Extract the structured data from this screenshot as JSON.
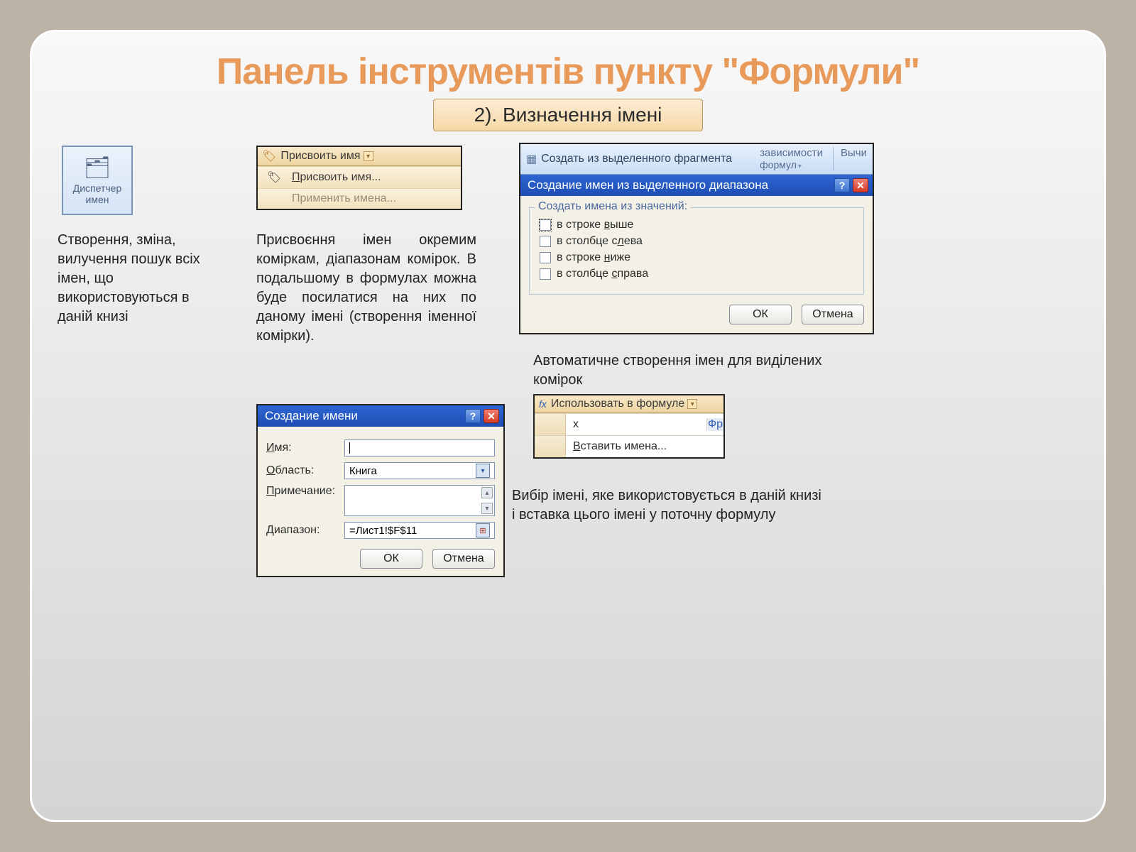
{
  "title": "Панель інструментів пункту \"Формули\"",
  "subtitle": "2). Визначення імені",
  "manager": {
    "label": "Диспетчер\nимен",
    "description": "Створення, зміна, вилучення пошук всіх імен, що використовуються в даній книзі"
  },
  "assign_menu": {
    "header": "Присвоить имя",
    "item1_pre": "П",
    "item1_rest": "рисвоить имя...",
    "item2": "Применить имена...",
    "description": "Присвоєння імен окремим коміркам, діапазонам комірок. В подальшому в формулах можна буде посилатися на них по даному імені (створення іменної комірки)."
  },
  "create_from_selection": {
    "strip_label": "Создать из выделенного фрагмента",
    "strip_right1": "зависимости",
    "strip_right2": "Вычи",
    "strip_right1_sub": "формул",
    "dialog_title": "Создание имен из выделенного диапазона",
    "legend": "Создать имена из значений:",
    "opt1_pre": "в строке ",
    "opt1_ul": "в",
    "opt1_rest": "ыше",
    "opt2_pre": "в столбце с",
    "opt2_ul": "л",
    "opt2_rest": "ева",
    "opt3_pre": "в строке ",
    "opt3_ul": "н",
    "opt3_rest": "иже",
    "opt4_pre": "в столбце ",
    "opt4_ul": "с",
    "opt4_rest": "права",
    "ok": "ОК",
    "cancel": "Отмена",
    "description": "Автоматичне створення імен для виділених комірок"
  },
  "use_in_formula": {
    "header": "Использовать в формуле",
    "item1": "x",
    "item2_ul": "В",
    "item2_rest": "ставить имена...",
    "stub": "Фр",
    "description": "Вибір імені, яке використовується в даній книзі і вставка цього імені у поточну формулу"
  },
  "create_name": {
    "title": "Создание имени",
    "name_lbl_ul": "И",
    "name_lbl_rest": "мя:",
    "scope_lbl_ul": "О",
    "scope_lbl_rest": "бласть:",
    "scope_value": "Книга",
    "comment_lbl_ul": "П",
    "comment_lbl_rest": "римечание:",
    "range_lbl_ul": "Д",
    "range_lbl_rest": "иапазон:",
    "range_value": "=Лист1!$F$11",
    "ok": "ОК",
    "cancel": "Отмена"
  }
}
